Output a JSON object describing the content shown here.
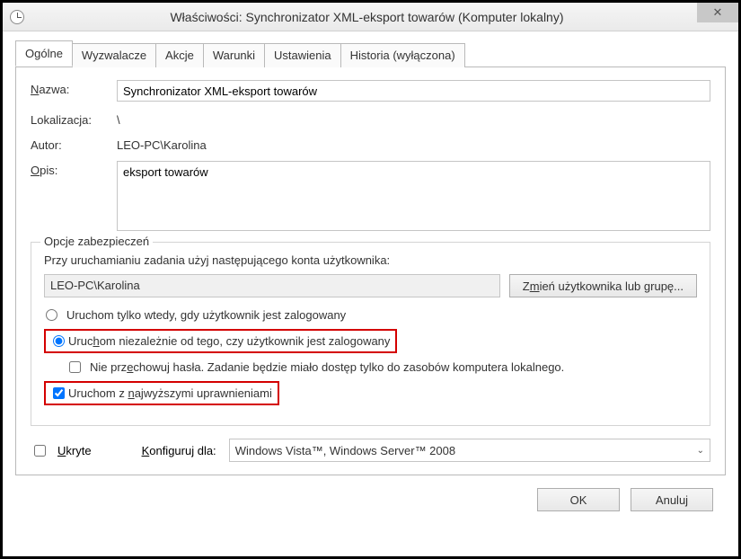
{
  "window": {
    "title": "Właściwości: Synchronizator XML-eksport towarów (Komputer lokalny)"
  },
  "tabs": {
    "general": "Ogólne",
    "triggers": "Wyzwalacze",
    "actions": "Akcje",
    "conditions": "Warunki",
    "settings": "Ustawienia",
    "history": "Historia (wyłączona)"
  },
  "general": {
    "name_label": "Nazwa:",
    "name_value": "Synchronizator XML-eksport towarów",
    "location_label": "Lokalizacja:",
    "location_value": "\\",
    "author_label": "Autor:",
    "author_value": "LEO-PC\\Karolina",
    "description_label": "Opis:",
    "description_value": "eksport towarów"
  },
  "security": {
    "legend": "Opcje zabezpieczeń",
    "prompt": "Przy uruchamianiu zadania użyj następującego konta użytkownika:",
    "account": "LEO-PC\\Karolina",
    "change_user_btn": "Zmień użytkownika lub grupę...",
    "radio_logged_on": "Uruchom tylko wtedy, gdy użytkownik jest zalogowany",
    "radio_any": "Uruchom niezależnie od tego, czy użytkownik jest zalogowany",
    "no_store_pwd": "Nie przechowuj hasła. Zadanie będzie miało dostęp tylko do zasobów komputera lokalnego.",
    "highest_priv": "Uruchom z najwyższymi uprawnieniami"
  },
  "bottom": {
    "hidden_label": "Ukryte",
    "configure_label": "Konfiguruj dla:",
    "configure_value": "Windows Vista™, Windows Server™ 2008"
  },
  "buttons": {
    "ok": "OK",
    "cancel": "Anuluj"
  }
}
